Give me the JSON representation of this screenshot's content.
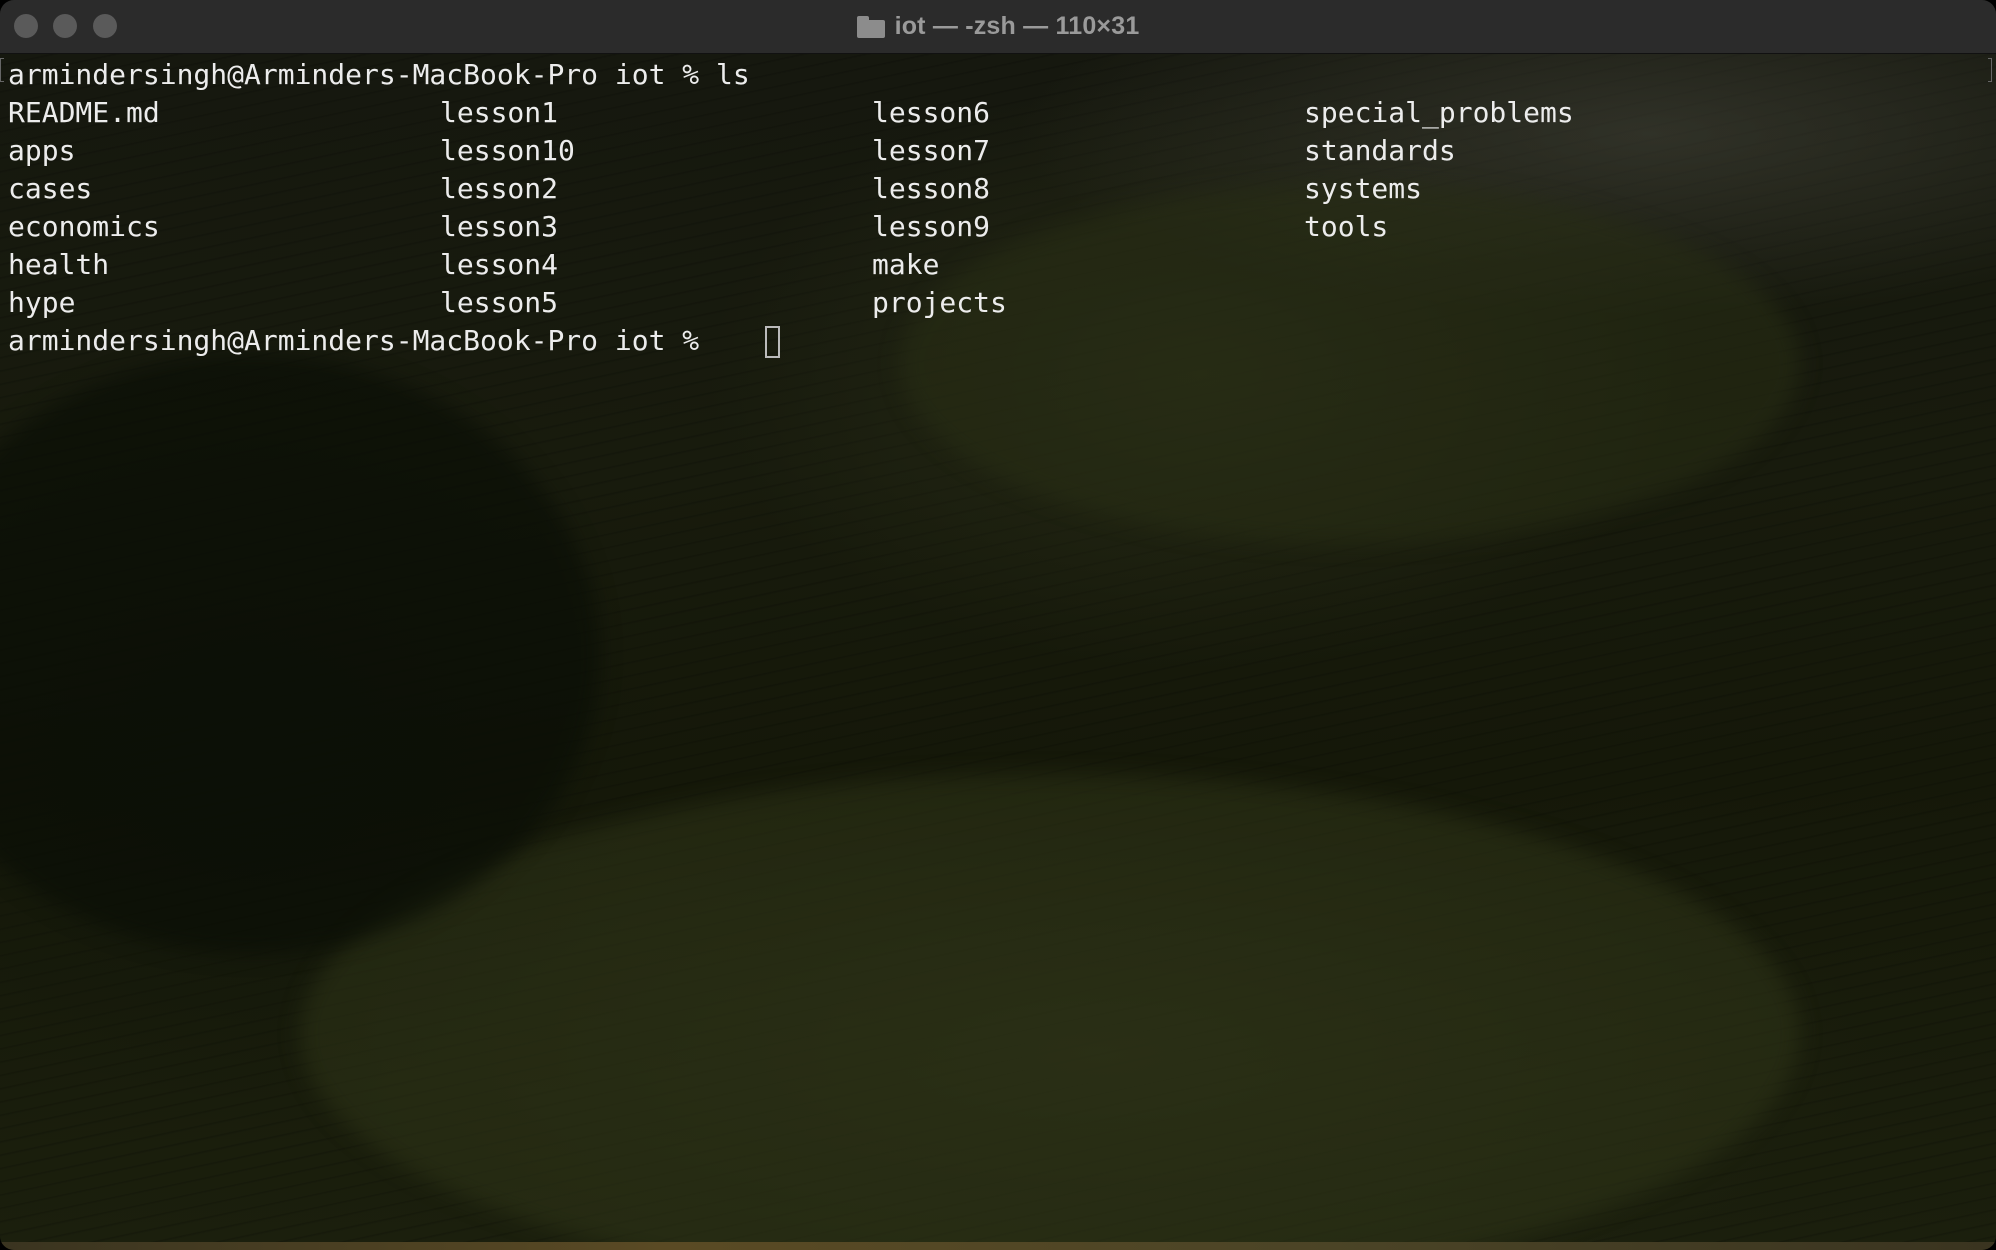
{
  "window": {
    "title": "iot — -zsh — 110×31",
    "title_icon": "folder-icon"
  },
  "terminal": {
    "command_line": {
      "prompt": "armindersingh@Arminders-MacBook-Pro iot % ls"
    },
    "listing": [
      [
        "README.md",
        "lesson1",
        "lesson6",
        "special_problems"
      ],
      [
        "apps",
        "lesson10",
        "lesson7",
        "standards"
      ],
      [
        "cases",
        "lesson2",
        "lesson8",
        "systems"
      ],
      [
        "economics",
        "lesson3",
        "lesson9",
        "tools"
      ],
      [
        "health",
        "lesson4",
        "make",
        ""
      ],
      [
        "hype",
        "lesson5",
        "projects",
        ""
      ]
    ],
    "current_prompt": "armindersingh@Arminders-MacBook-Pro iot % "
  },
  "colors": {
    "text": "#ececec",
    "titlebar": "#2b2b2b",
    "title_text": "#9a9a9a",
    "traffic_light_inactive": "#5a5a5a"
  }
}
